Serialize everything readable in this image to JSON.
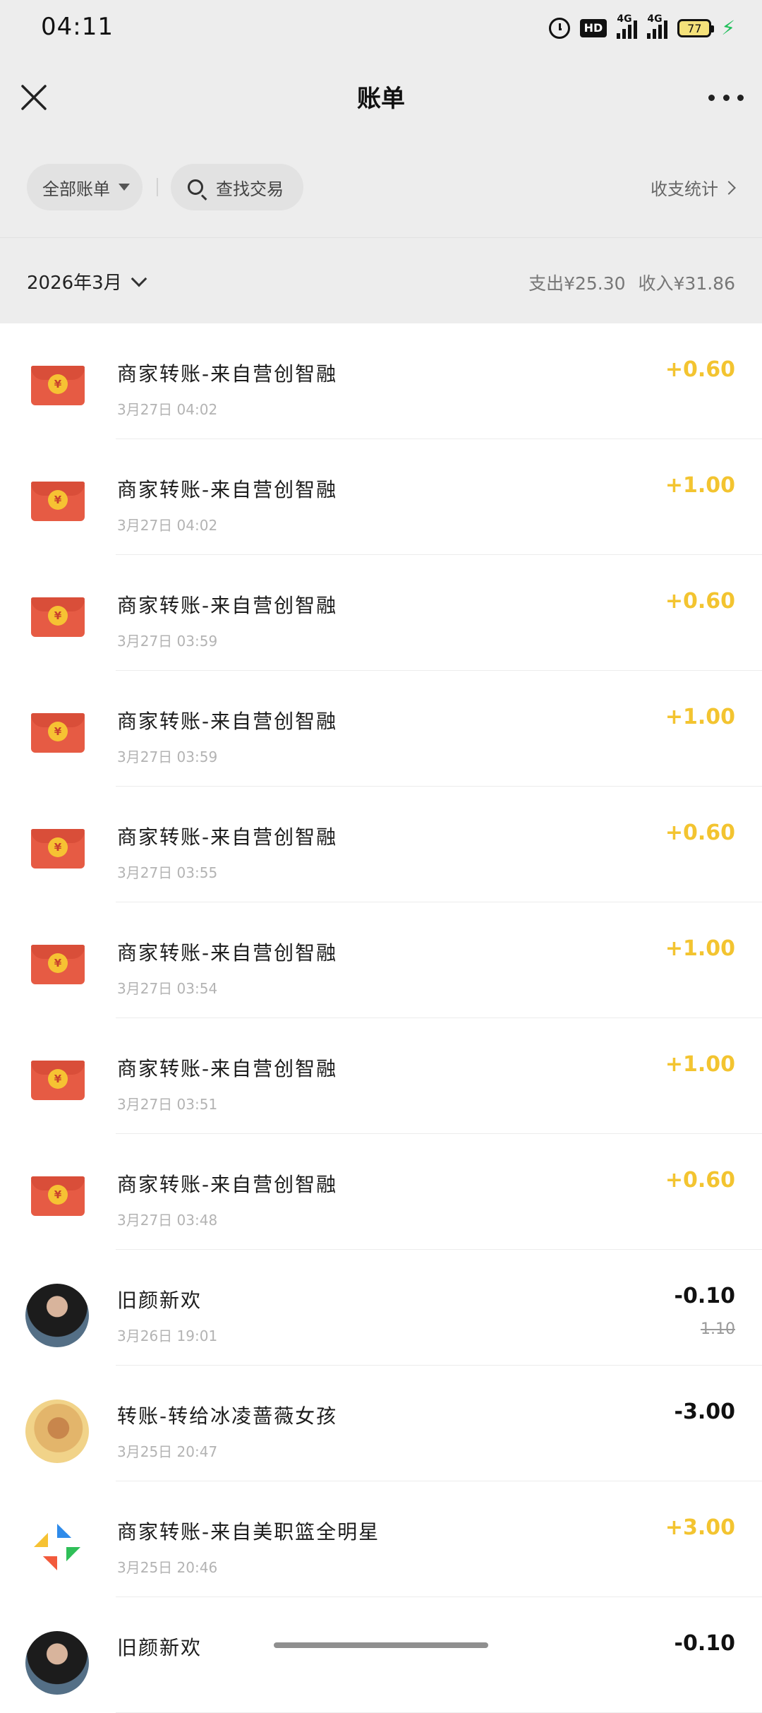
{
  "status_bar": {
    "time": "04:11",
    "hd_label": "HD",
    "network_1": "4G",
    "network_2": "4G",
    "battery": "77"
  },
  "nav": {
    "title": "账单",
    "close_icon": "close-icon",
    "more_icon": "more-icon"
  },
  "filters": {
    "all_bills": "全部账单",
    "search_placeholder": "查找交易",
    "stats_link": "收支统计"
  },
  "month": {
    "label": "2026年3月",
    "expense": "支出¥25.30",
    "income": "收入¥31.86"
  },
  "transactions": [
    {
      "icon": "red-packet-icon",
      "title": "商家转账-来自营创智融",
      "date": "3月27日 04:02",
      "amount": "+0.60",
      "type": "income"
    },
    {
      "icon": "red-packet-icon",
      "title": "商家转账-来自营创智融",
      "date": "3月27日 04:02",
      "amount": "+1.00",
      "type": "income"
    },
    {
      "icon": "red-packet-icon",
      "title": "商家转账-来自营创智融",
      "date": "3月27日 03:59",
      "amount": "+0.60",
      "type": "income"
    },
    {
      "icon": "red-packet-icon",
      "title": "商家转账-来自营创智融",
      "date": "3月27日 03:59",
      "amount": "+1.00",
      "type": "income"
    },
    {
      "icon": "red-packet-icon",
      "title": "商家转账-来自营创智融",
      "date": "3月27日 03:55",
      "amount": "+0.60",
      "type": "income"
    },
    {
      "icon": "red-packet-icon",
      "title": "商家转账-来自营创智融",
      "date": "3月27日 03:54",
      "amount": "+1.00",
      "type": "income"
    },
    {
      "icon": "red-packet-icon",
      "title": "商家转账-来自营创智融",
      "date": "3月27日 03:51",
      "amount": "+1.00",
      "type": "income"
    },
    {
      "icon": "red-packet-icon",
      "title": "商家转账-来自营创智融",
      "date": "3月27日 03:48",
      "amount": "+0.60",
      "type": "income"
    },
    {
      "icon": "avatar-photo",
      "title": "旧颜新欢",
      "date": "3月26日 19:01",
      "amount": "-0.10",
      "original_amount": "1.10",
      "type": "expense"
    },
    {
      "icon": "avatar-photo",
      "title": "转账-转给冰凌蔷薇女孩",
      "date": "3月25日 20:47",
      "amount": "-3.00",
      "type": "expense"
    },
    {
      "icon": "app-logo-icon",
      "title": "商家转账-来自美职篮全明星",
      "date": "3月25日 20:46",
      "amount": "+3.00",
      "type": "income"
    },
    {
      "icon": "avatar-photo",
      "title": "旧颜新欢",
      "date": "",
      "amount": "-0.10",
      "type": "expense"
    }
  ],
  "colors": {
    "income": "#f3c430",
    "expense": "#111111",
    "red_packet": "#e65b44",
    "header_bg": "#ededed"
  }
}
